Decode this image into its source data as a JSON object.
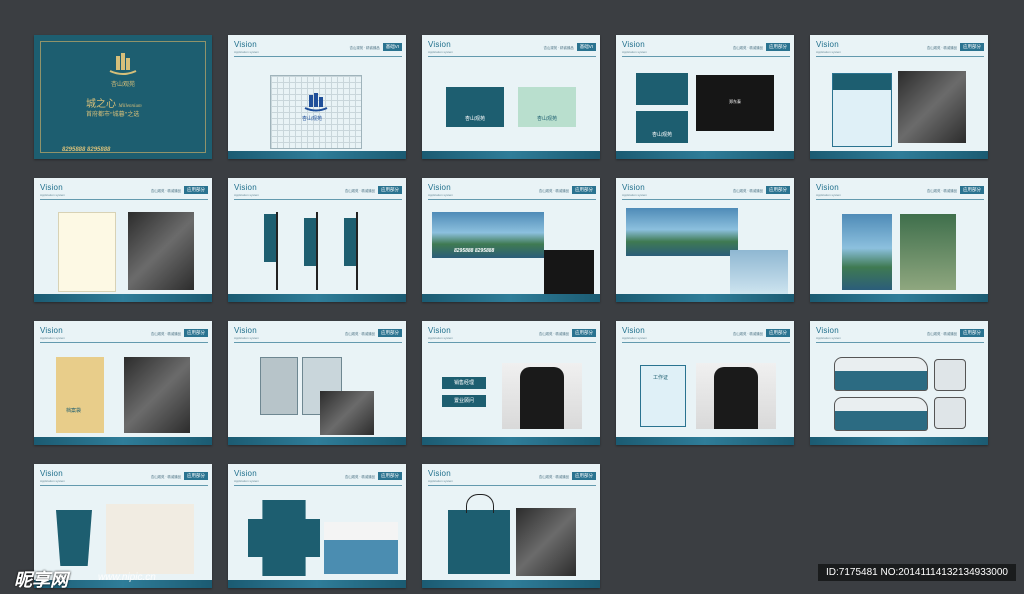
{
  "cover": {
    "project_name": "杏山观苑",
    "slogan_main": "城之心",
    "slogan_en": "Millennium",
    "slogan_line": "首府都市“城暮”之选",
    "phones": "8295888 8295888"
  },
  "page": {
    "brand": "Vision",
    "brand_sub": "Application system",
    "header_mini": "杏山观苑 · 精诚臻品",
    "tag_basic": "基础VI",
    "tag_app": "应用部分"
  },
  "labels": {
    "grid_name": "杏山观苑",
    "logo_name": "杏山观苑",
    "bcard_name": "杏山观苑",
    "bcard_person": "郑东泰",
    "banner_text": "杏山观苑",
    "billboard_phone": "8295888 8295888",
    "folder_label": "档案袋",
    "sign_manager": "销售经理",
    "sign_advisor": "置业顾问",
    "work_card": "工作证",
    "watermark_brand": "昵享网",
    "watermark_url": "www.nipic.cn",
    "image_id": "ID:7175481 NO:20141114132134933000"
  },
  "colors": {
    "background": "#3b3e42",
    "page": "#e9f3f6",
    "brand_dark": "#1d5e70",
    "accent": "#2a7390",
    "gold": "#d6bf7a"
  }
}
